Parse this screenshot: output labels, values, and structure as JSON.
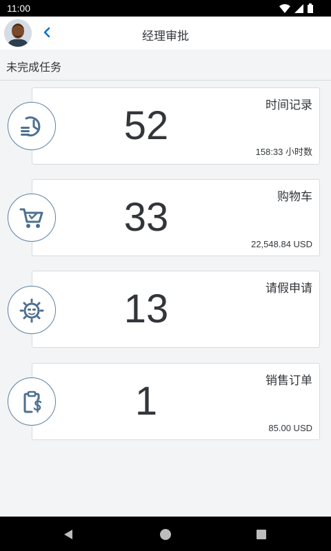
{
  "status_bar": {
    "time": "11:00"
  },
  "header": {
    "title": "经理审批"
  },
  "section": {
    "title": "未完成任务"
  },
  "cards": [
    {
      "title": "时间记录",
      "count": "52",
      "subtitle": "158:33 小时数",
      "icon": "time-history-icon"
    },
    {
      "title": "购物车",
      "count": "33",
      "subtitle": "22,548.84 USD",
      "icon": "cart-icon"
    },
    {
      "title": "请假申请",
      "count": "13",
      "subtitle": "",
      "icon": "leave-sun-icon"
    },
    {
      "title": "销售订单",
      "count": "1",
      "subtitle": "85.00 USD",
      "icon": "clipboard-dollar-icon"
    }
  ],
  "colors": {
    "accent": "#0a6ed1",
    "icon": "#4e6f91",
    "text": "#32363a",
    "background": "#f2f4f5"
  }
}
